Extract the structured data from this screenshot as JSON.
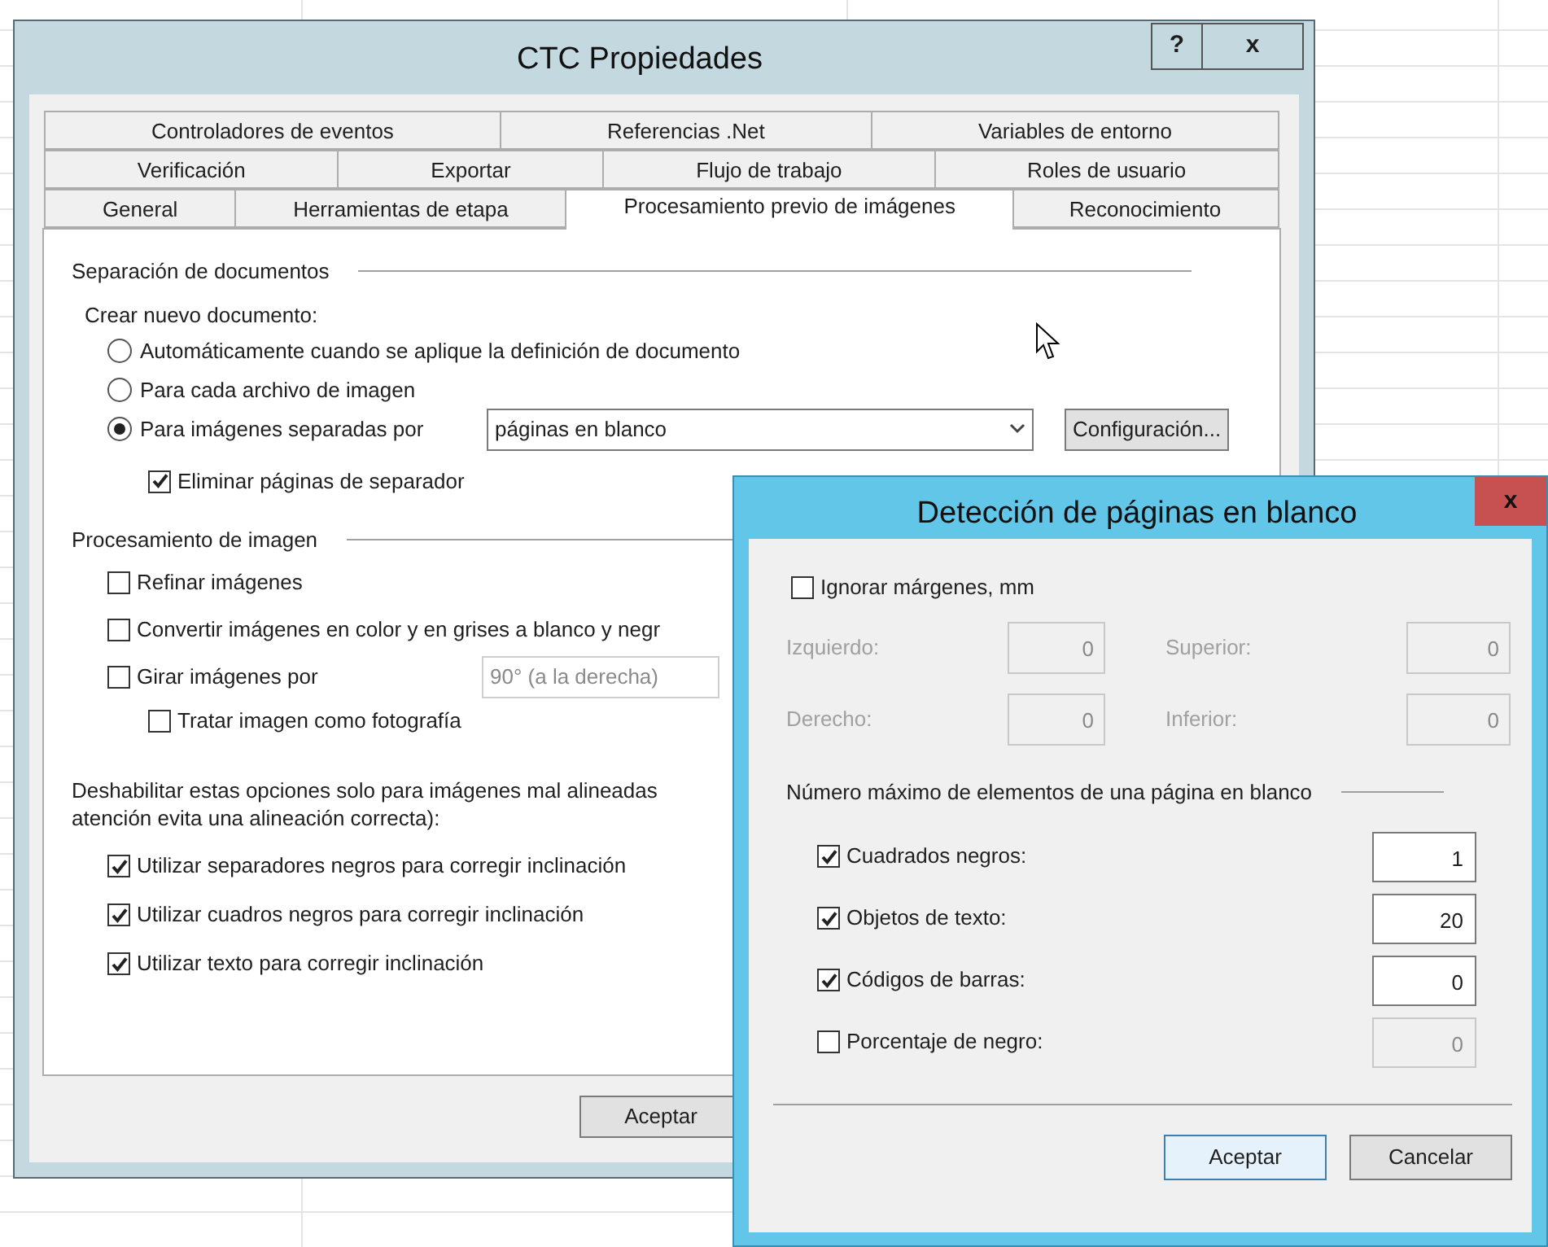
{
  "window": {
    "title": "CTC Propiedades",
    "help_button": "?",
    "close_button": "x"
  },
  "tab_rows": [
    [
      {
        "label": "Controladores de eventos",
        "selected": false
      },
      {
        "label": "Referencias .Net",
        "selected": false
      },
      {
        "label": "Variables de entorno",
        "selected": false
      }
    ],
    [
      {
        "label": "Verificación",
        "selected": false
      },
      {
        "label": "Exportar",
        "selected": false
      },
      {
        "label": "Flujo de trabajo",
        "selected": false
      },
      {
        "label": "Roles de usuario",
        "selected": false
      }
    ],
    [
      {
        "label": "General",
        "selected": false
      },
      {
        "label": "Herramientas de etapa",
        "selected": false
      },
      {
        "label": "Procesamiento previo de imágenes",
        "selected": true
      },
      {
        "label": "Reconocimiento",
        "selected": false
      }
    ]
  ],
  "document_separation": {
    "heading": "Separación de documentos",
    "subheading": "Crear nuevo documento:",
    "options": [
      {
        "label": "Automáticamente cuando se aplique la definición de documento",
        "selected": false
      },
      {
        "label": "Para cada archivo de imagen",
        "selected": false
      },
      {
        "label": "Para imágenes separadas por",
        "selected": true
      }
    ],
    "separator_dropdown": {
      "value": "páginas en blanco"
    },
    "settings_button": "Configuración...",
    "delete_separators": {
      "label": "Eliminar páginas de separador",
      "checked": true
    }
  },
  "image_processing": {
    "heading": "Procesamiento de imagen",
    "items": [
      {
        "kind": "check",
        "label": "Refinar imágenes",
        "checked": false
      },
      {
        "kind": "check",
        "label": "Convertir imágenes en color y en grises a blanco y negr",
        "checked": false
      },
      {
        "kind": "check_dropdown",
        "label": "Girar imágenes por",
        "checked": false,
        "dropdown_value": "90° (a la derecha)"
      },
      {
        "kind": "sub_check",
        "label": "Tratar imagen como fotografía",
        "checked": false
      }
    ]
  },
  "deskew": {
    "note_lines": [
      "Deshabilitar estas opciones solo para imágenes mal alineadas",
      "atención evita una alineación correcta):"
    ],
    "options": [
      {
        "label": "Utilizar separadores negros para corregir inclinación",
        "checked": true
      },
      {
        "label": "Utilizar cuadros negros para corregir inclinación",
        "checked": true
      },
      {
        "label": "Utilizar texto para corregir inclinación",
        "checked": true
      }
    ]
  },
  "buttons": [
    "Aceptar"
  ],
  "dialog": {
    "title": "Detección de páginas en blanco",
    "close_button": "x",
    "ignore_margins": {
      "label": "Ignorar márgenes, mm",
      "checked": false
    },
    "margins": [
      {
        "label": "Izquierdo:",
        "value": "0"
      },
      {
        "label": "Superior:",
        "value": "0"
      },
      {
        "label": "Derecho:",
        "value": "0"
      },
      {
        "label": "Inferior:",
        "value": "0"
      }
    ],
    "elements_heading": "Número máximo de elementos de una página en blanco",
    "elements": [
      {
        "label": "Cuadrados negros:",
        "checked": true,
        "value": "1"
      },
      {
        "label": "Objetos de texto:",
        "checked": true,
        "value": "20"
      },
      {
        "label": "Códigos de barras:",
        "checked": true,
        "value": "0"
      },
      {
        "label": "Porcentaje de negro:",
        "checked": false,
        "value": "0"
      }
    ],
    "buttons": [
      {
        "label": "Aceptar",
        "default": true
      },
      {
        "label": "Cancelar",
        "default": false
      }
    ]
  }
}
